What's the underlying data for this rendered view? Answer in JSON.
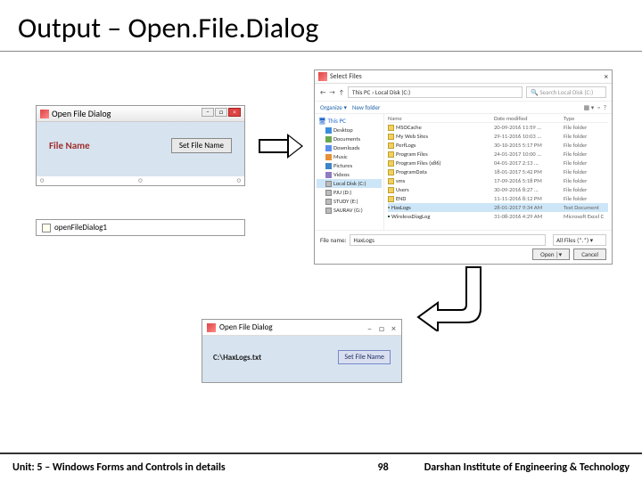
{
  "title": "Output – Open.File.Dialog",
  "win1": {
    "title": "Open File Dialog",
    "label": "File Name",
    "button": "Set File Name"
  },
  "tray": {
    "component": "openFileDialog1"
  },
  "win2": {
    "title": "Select Files",
    "path": "This PC › Local Disk (C:)",
    "searchPlaceholder": "Search Local Disk (C:)",
    "organize": "Organize ▾",
    "newfolder": "New folder",
    "sidebarHeader": "This PC",
    "sidebar": [
      {
        "label": "Desktop",
        "cls": "i-desktop"
      },
      {
        "label": "Documents",
        "cls": "i-docs"
      },
      {
        "label": "Downloads",
        "cls": "i-down"
      },
      {
        "label": "Music",
        "cls": "i-music"
      },
      {
        "label": "Pictures",
        "cls": "i-pics"
      },
      {
        "label": "Videos",
        "cls": "i-videos"
      },
      {
        "label": "Local Disk (C:)",
        "cls": "i-disk",
        "sel": true
      },
      {
        "label": "PJU (D:)",
        "cls": "i-disk"
      },
      {
        "label": "STUDY (E:)",
        "cls": "i-disk"
      },
      {
        "label": "SAURAV (G:)",
        "cls": "i-disk"
      }
    ],
    "cols": {
      "name": "Name",
      "date": "Date modified",
      "type": "Type"
    },
    "files": [
      {
        "name": "MSOCache",
        "date": "20-09-2016 11:59 ...",
        "type": "File folder",
        "ico": "f-ico"
      },
      {
        "name": "My Web Sites",
        "date": "29-11-2016 10:03 ...",
        "type": "File folder",
        "ico": "f-ico"
      },
      {
        "name": "PerfLogs",
        "date": "30-10-2015 5:17 PM",
        "type": "File folder",
        "ico": "f-ico"
      },
      {
        "name": "Program Files",
        "date": "24-01-2017 10:00 ...",
        "type": "File folder",
        "ico": "f-ico"
      },
      {
        "name": "Program Files (x86)",
        "date": "04-01-2017 2:13 ...",
        "type": "File folder",
        "ico": "f-ico"
      },
      {
        "name": "ProgramData",
        "date": "18-01-2017 5:42 PM",
        "type": "File folder",
        "ico": "f-ico"
      },
      {
        "name": "sms",
        "date": "17-09-2016 5:18 PM",
        "type": "File folder",
        "ico": "f-ico"
      },
      {
        "name": "Users",
        "date": "30-09-2016 8:27 ...",
        "type": "File folder",
        "ico": "f-ico"
      },
      {
        "name": "END",
        "date": "11-11-2016 8:12 PM",
        "type": "File folder",
        "ico": "f-ico"
      },
      {
        "name": "HaxLogs",
        "date": "28-01-2017 9:34 AM",
        "type": "Text Document",
        "ico": "f-txt",
        "sel": true
      },
      {
        "name": "WirelessDiagLog",
        "date": "31-08-2016 4:29 AM",
        "type": "Microsoft Excel C",
        "ico": "f-xls"
      }
    ],
    "filenameLabel": "File name:",
    "filenameValue": "HaxLogs",
    "filter": "All Files (*.*)",
    "open": "Open",
    "cancel": "Cancel"
  },
  "win3": {
    "title": "Open File Dialog",
    "path": "C:\\HaxLogs.txt",
    "button": "Set File Name"
  },
  "footer": {
    "unit": "Unit: 5 – Windows Forms and Controls in details",
    "page": "98",
    "inst": "Darshan Institute of Engineering & Technology"
  }
}
